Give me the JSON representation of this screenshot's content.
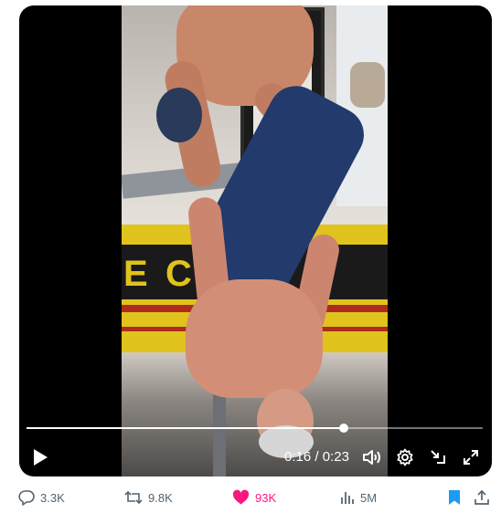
{
  "video": {
    "elapsed": "0:16",
    "separator": " / ",
    "duration": "0:23",
    "progress_fraction": 0.696,
    "scene_letters": [
      "E",
      "C"
    ]
  },
  "actions": {
    "replies": "3.3K",
    "retweets": "9.8K",
    "likes": "93K",
    "views": "5M"
  },
  "colors": {
    "like_active": "#f91880",
    "bookmark_active": "#1d9bf0",
    "muted_text": "#536471"
  },
  "icons": {
    "play": "play-icon",
    "volume": "volume-icon",
    "settings": "gear-icon",
    "minimize": "minimize-icon",
    "fullscreen": "fullscreen-icon",
    "reply": "reply-icon",
    "retweet": "retweet-icon",
    "like": "heart-icon",
    "views": "views-icon",
    "bookmark": "bookmark-icon",
    "share": "share-icon"
  }
}
